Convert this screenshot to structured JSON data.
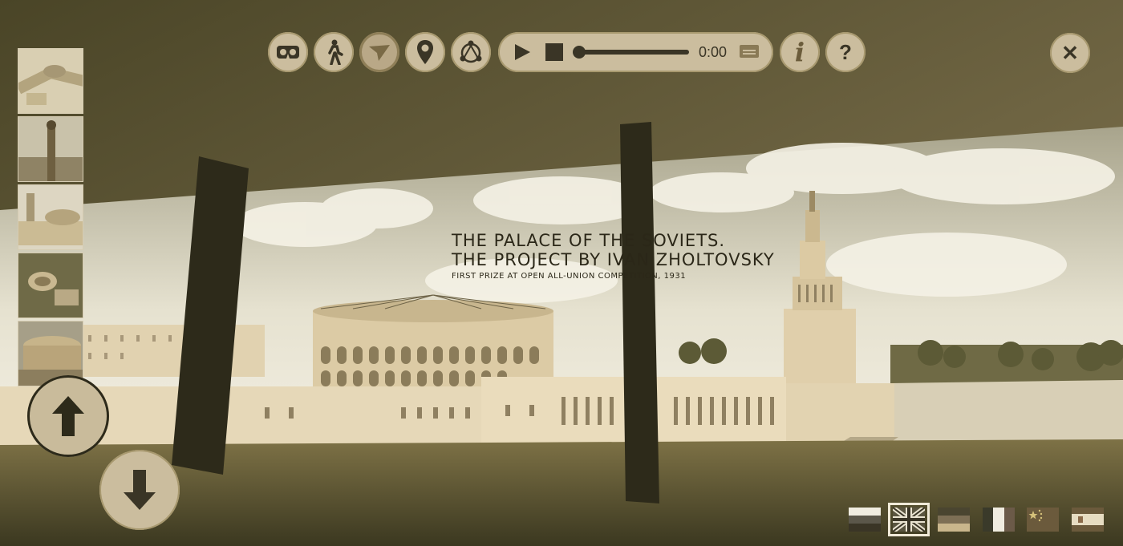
{
  "toolbar": {
    "buttons": [
      {
        "name": "vr-headset-icon",
        "active": false
      },
      {
        "name": "walk-icon",
        "active": false
      },
      {
        "name": "fly-icon",
        "active": true
      },
      {
        "name": "map-pin-icon",
        "active": false
      },
      {
        "name": "orbit-icon",
        "active": false
      }
    ],
    "player": {
      "time": "0:00",
      "progress": 0
    },
    "info_label": "i",
    "help_label": "?"
  },
  "close_label": "✕",
  "caption": {
    "line1": "THE PALACE OF THE SOVIETS.",
    "line2": "THE PROJECT BY IVAN ZHOLTOVSKY",
    "line3": "FIRST PRIZE AT OPEN ALL-UNION COMPETITION, 1931"
  },
  "thumbnails": [
    {
      "name": "aerial-overview",
      "selected": false
    },
    {
      "name": "tower-statue",
      "selected": false
    },
    {
      "name": "palace-front",
      "selected": false
    },
    {
      "name": "colosseum-aerial",
      "selected": false
    },
    {
      "name": "colosseum-front",
      "selected": true
    }
  ],
  "navigation": {
    "up": "up-arrow-icon",
    "down": "down-arrow-icon"
  },
  "languages": [
    {
      "code": "ru",
      "selected": false
    },
    {
      "code": "en",
      "selected": true
    },
    {
      "code": "de",
      "selected": false
    },
    {
      "code": "it",
      "selected": false
    },
    {
      "code": "cn",
      "selected": false
    },
    {
      "code": "es",
      "selected": false
    }
  ],
  "colors": {
    "ui_fill": "#cbbd9e",
    "frame": "#3f3a22",
    "text": "#2b2718"
  }
}
